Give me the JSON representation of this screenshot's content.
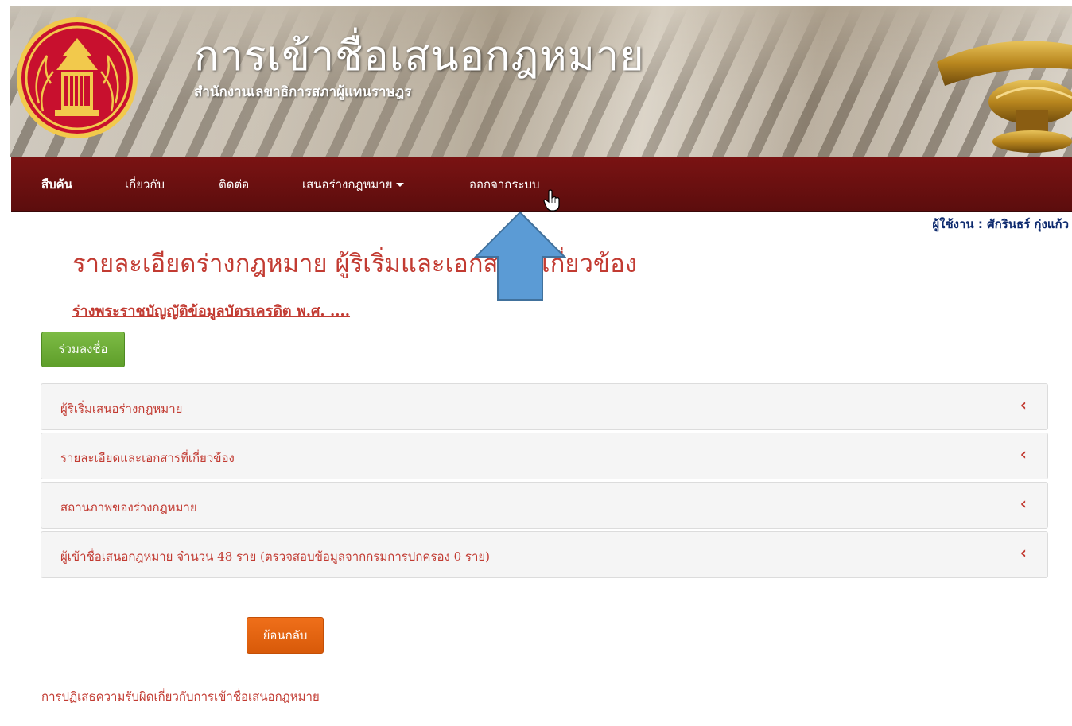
{
  "header": {
    "title": "การเข้าชื่อเสนอกฎหมาย",
    "subtitle": "สำนักงานเลขาธิการสภาผู้แทนราษฎร"
  },
  "nav": {
    "items": [
      {
        "label": "สืบค้น"
      },
      {
        "label": "เกี่ยวกับ"
      },
      {
        "label": "ติดต่อ"
      },
      {
        "label": "เสนอร่างกฎหมาย"
      },
      {
        "label": "ออกจากระบบ"
      }
    ]
  },
  "user": {
    "label": "ผู้ใช้งาน : ศักรินธร์ กุ่งแก้ว"
  },
  "main": {
    "heading": "รายละเอียดร่างกฎหมาย ผู้ริเริ่มและเอกสารที่เกี่ยวข้อง",
    "bill_title": "ร่างพระราชบัญญัติข้อมูลบัตรเครดิต พ.ศ. ....",
    "sign_button": "ร่วมลงชื่อ",
    "accordion": [
      {
        "label": "ผู้ริเริ่มเสนอร่างกฎหมาย",
        "chevron": "‹"
      },
      {
        "label": "รายละเอียดและเอกสารที่เกี่ยวข้อง",
        "chevron": "‹"
      },
      {
        "label": "สถานภาพของร่างกฎหมาย",
        "chevron": "‹"
      },
      {
        "label": "ผู้เข้าชื่อเสนอกฎหมาย  จำนวน  48  ราย  (ตรวจสอบข้อมูลจากกรมการปกครอง 0 ราย)",
        "chevron": "‹"
      }
    ],
    "back_button": "ย้อนกลับ"
  },
  "footer": {
    "disclaimer": "การปฏิเสธความรับผิดเกี่ยวกับการเข้าชื่อเสนอกฎหมาย"
  },
  "colors": {
    "nav_bg": "#6b1010",
    "accent_red": "#c23b32",
    "sign_green": "#6aaa35",
    "back_orange": "#e5640f",
    "user_blue": "#0d2a6e",
    "annotation_arrow": "#5b9bd5"
  },
  "icons": {
    "emblem": "parliament-emblem-icon",
    "nav_caret": "caret-down-icon",
    "accordion_chevron": "chevron-left-icon",
    "cursor": "hand-pointer-cursor-icon",
    "annotation": "up-arrow-annotation"
  }
}
